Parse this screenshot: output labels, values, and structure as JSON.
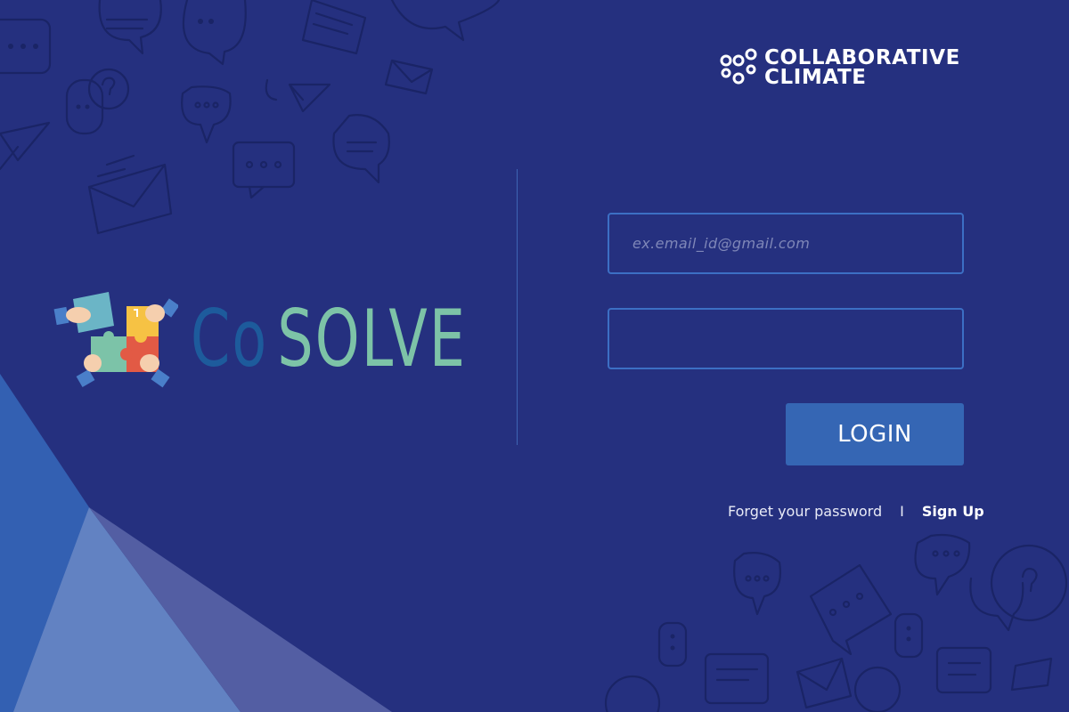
{
  "brand": {
    "company_line1": "Collaborative",
    "company_line2": "Climate",
    "product_prefix": "Co",
    "product_suffix": "SOLVE"
  },
  "form": {
    "email_placeholder": "ex.email_id@gmail.com",
    "password_placeholder": "",
    "login_label": "LOGIN"
  },
  "links": {
    "forgot_label": "Forget your password",
    "separator": "I",
    "signup_label": "Sign Up"
  },
  "colors": {
    "background": "#25307f",
    "accent": "#3566b4",
    "co_color": "#1d5b9c",
    "solve_color": "#7dc3a7"
  }
}
